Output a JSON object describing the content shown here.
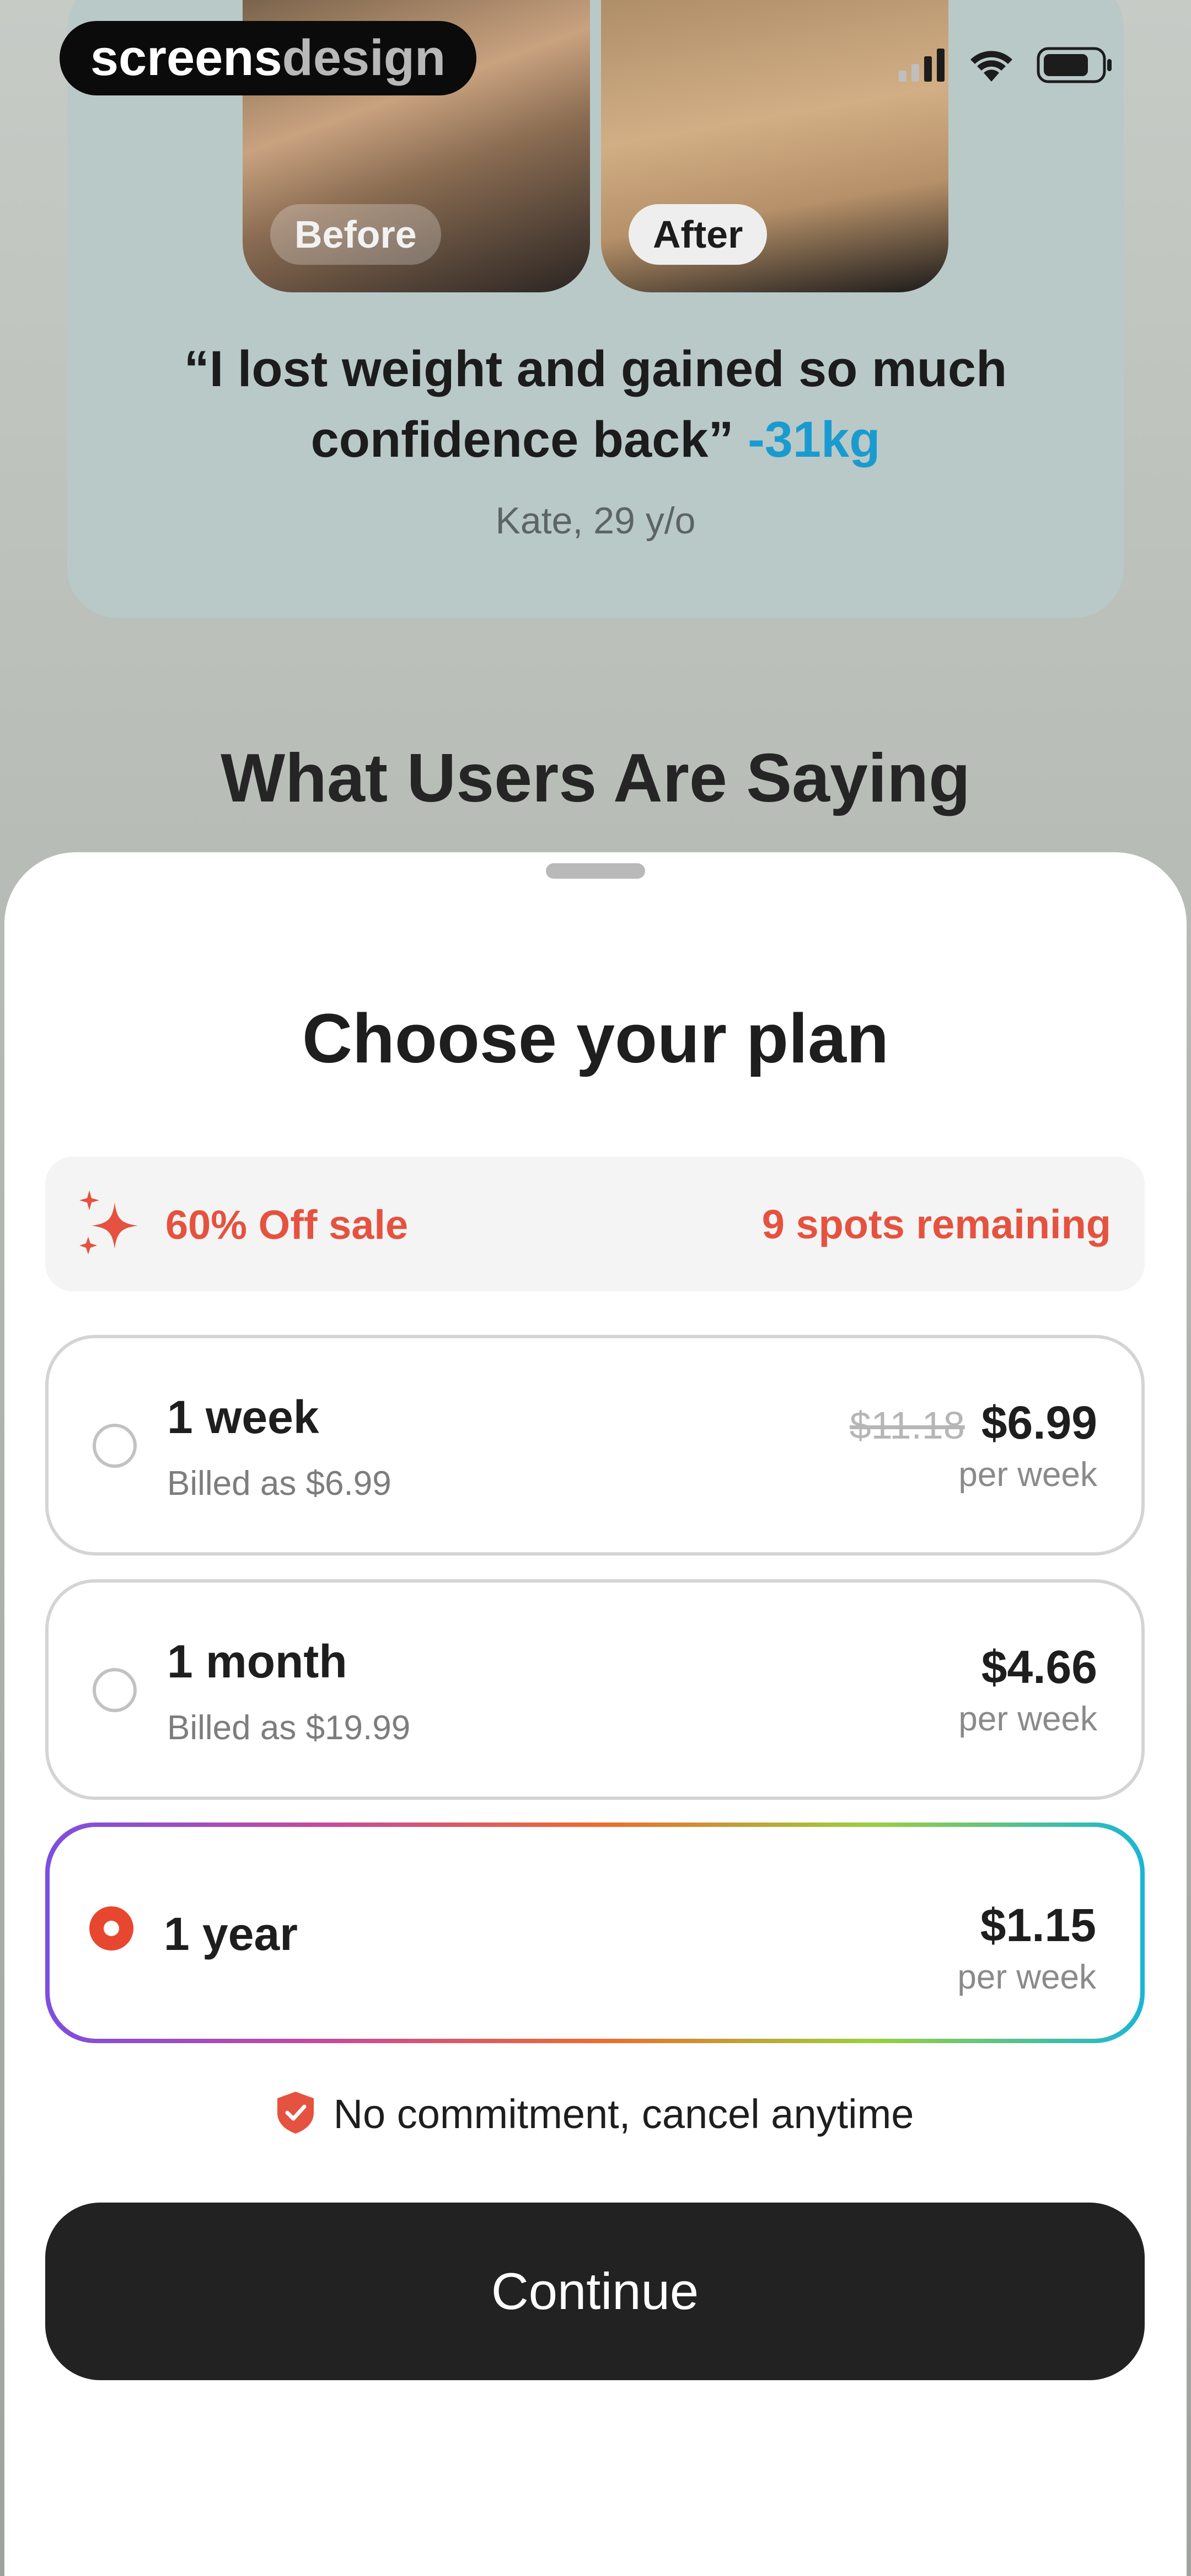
{
  "brand": {
    "part1": "screens",
    "part2": "design"
  },
  "status_bar": {
    "signal_icon": "signal-icon",
    "wifi_icon": "wifi-icon",
    "battery_icon": "battery-icon"
  },
  "testimonial": {
    "before_label": "Before",
    "after_label": "After",
    "quote": "“I lost weight and gained so much confidence back”",
    "result": "-31kg",
    "author": "Kate, 29 y/o"
  },
  "section_title": "What Users Are Saying",
  "sheet": {
    "title": "Choose your plan",
    "sale": {
      "label": "60% Off sale",
      "spots": "9 spots remaining",
      "icon": "sparkle-icon",
      "color": "#e5523f"
    },
    "plans": [
      {
        "name": "1 week",
        "billed": "Billed as $6.99",
        "old_price": "$11.18",
        "price": "$6.99",
        "per": "per week",
        "selected": false
      },
      {
        "name": "1 month",
        "billed": "Billed as $19.99",
        "price": "$4.66",
        "per": "per week",
        "selected": false
      },
      {
        "name": "1 year",
        "price": "$1.15",
        "per": "per week",
        "selected": true
      }
    ],
    "commitment": "No commitment, cancel anytime",
    "continue_label": "Continue"
  },
  "colors": {
    "accent": "#e5523f",
    "result": "#1a9bd0",
    "button": "#222222"
  }
}
